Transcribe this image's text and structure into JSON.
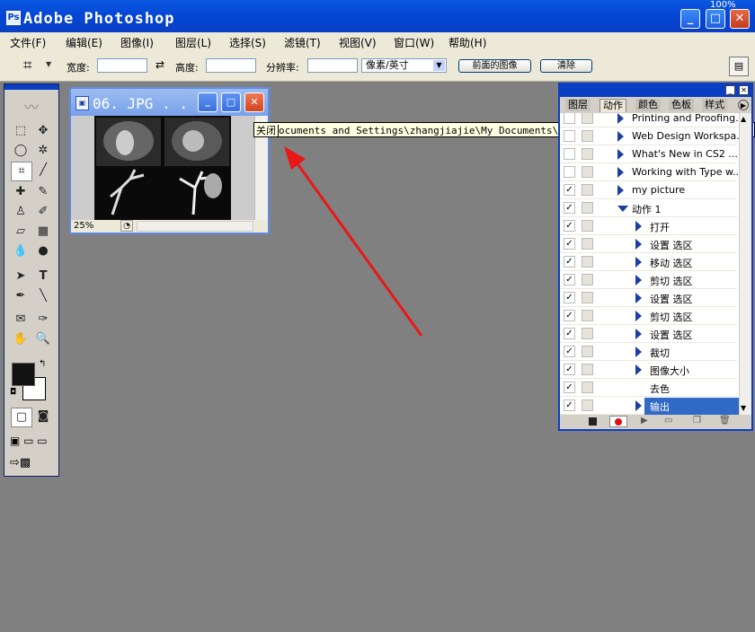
{
  "window": {
    "title": "Adobe Photoshop",
    "zoom_badge": "100%"
  },
  "menu": [
    "文件(F)",
    "编辑(E)",
    "图像(I)",
    "图层(L)",
    "选择(S)",
    "滤镜(T)",
    "视图(V)",
    "窗口(W)",
    "帮助(H)"
  ],
  "options": {
    "width_label": "宽度:",
    "height_label": "高度:",
    "resolution_label": "分辨率:",
    "unit_select": "像素/英寸",
    "front_image_button": "前面的图像",
    "clear_button": "清除",
    "width_value": "",
    "height_value": "",
    "resolution_value": ""
  },
  "document": {
    "title": "06. JPG . . .",
    "zoom": "25%"
  },
  "tooltip": {
    "label": "关闭",
    "path": "ocuments and Settings\\zhangjiajie\\My Documents\\My Pictures\\06.JPG @ 25%(RGB"
  },
  "panel": {
    "tabs": [
      "图层",
      "动作",
      "颜色",
      "色板",
      "样式"
    ],
    "active_tab": "动作",
    "actions": [
      {
        "label": "Printing and Proofing...",
        "checked": false,
        "expanded": false,
        "level": 0
      },
      {
        "label": "Web Design Workspa...",
        "checked": false,
        "expanded": false,
        "level": 0
      },
      {
        "label": "What's New in CS2 ...",
        "checked": false,
        "expanded": false,
        "level": 0
      },
      {
        "label": "Working with Type w...",
        "checked": false,
        "expanded": false,
        "level": 0
      },
      {
        "label": "my picture",
        "checked": true,
        "expanded": false,
        "level": 0
      },
      {
        "label": "动作 1",
        "checked": true,
        "expanded": true,
        "level": 0
      },
      {
        "label": "打开",
        "checked": true,
        "expanded": false,
        "level": 1
      },
      {
        "label": "设置 选区",
        "checked": true,
        "expanded": false,
        "level": 1
      },
      {
        "label": "移动 选区",
        "checked": true,
        "expanded": false,
        "level": 1
      },
      {
        "label": "剪切 选区",
        "checked": true,
        "expanded": false,
        "level": 1
      },
      {
        "label": "设置 选区",
        "checked": true,
        "expanded": false,
        "level": 1
      },
      {
        "label": "剪切 选区",
        "checked": true,
        "expanded": false,
        "level": 1
      },
      {
        "label": "设置 选区",
        "checked": true,
        "expanded": false,
        "level": 1
      },
      {
        "label": "裁切",
        "checked": true,
        "expanded": false,
        "level": 1
      },
      {
        "label": "图像大小",
        "checked": true,
        "expanded": false,
        "level": 1
      },
      {
        "label": "去色",
        "checked": true,
        "expanded": false,
        "level": 1,
        "no_arrow": true
      },
      {
        "label": "输出",
        "checked": true,
        "expanded": false,
        "level": 1,
        "selected": true
      }
    ]
  },
  "colors": {
    "titlebar": "#0a58e0",
    "annotation_arrow": "#e81818",
    "selection": "#316ac5"
  }
}
